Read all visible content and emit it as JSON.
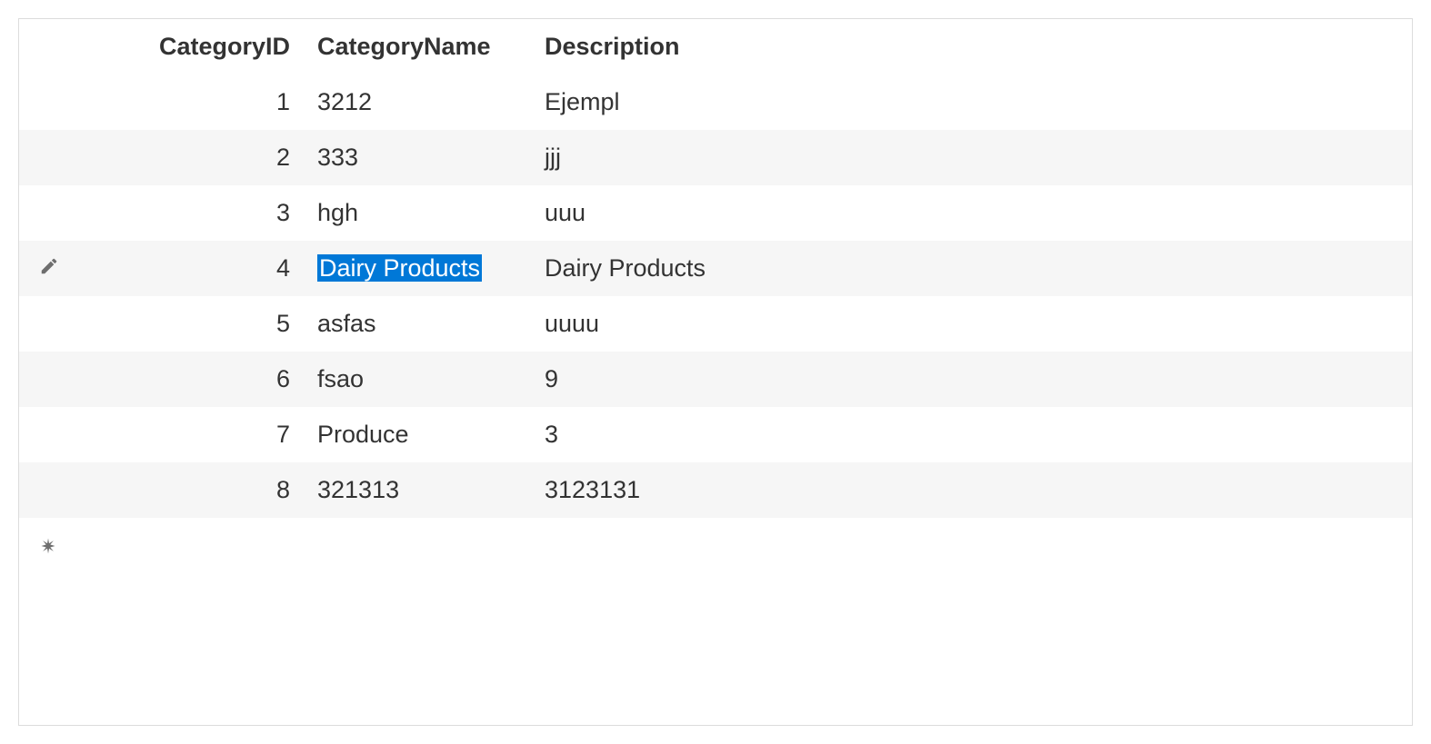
{
  "grid": {
    "columns": {
      "category_id": "CategoryID",
      "category_name": "CategoryName",
      "description": "Description"
    },
    "rows": [
      {
        "id": "1",
        "name": "3212",
        "desc": "Ejempl",
        "editing": false,
        "highlight_name": false
      },
      {
        "id": "2",
        "name": "333",
        "desc": "jjj",
        "editing": false,
        "highlight_name": false
      },
      {
        "id": "3",
        "name": "hgh",
        "desc": "uuu",
        "editing": false,
        "highlight_name": false
      },
      {
        "id": "4",
        "name": "Dairy Products",
        "desc": "Dairy Products",
        "editing": true,
        "highlight_name": true
      },
      {
        "id": "5",
        "name": "asfas",
        "desc": "uuuu",
        "editing": false,
        "highlight_name": false
      },
      {
        "id": "6",
        "name": "fsao",
        "desc": "9",
        "editing": false,
        "highlight_name": false
      },
      {
        "id": "7",
        "name": "Produce",
        "desc": "3",
        "editing": false,
        "highlight_name": false
      },
      {
        "id": "8",
        "name": "321313",
        "desc": "3123131",
        "editing": false,
        "highlight_name": false
      }
    ],
    "icons": {
      "edit": "pencil-icon",
      "new": "asterisk-icon"
    }
  }
}
